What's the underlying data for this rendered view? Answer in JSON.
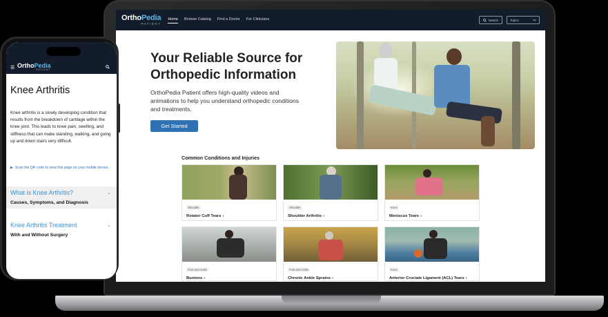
{
  "laptop": {
    "logo": {
      "part1": "Ortho",
      "part2": "Pedia",
      "sub": "PATIENT"
    },
    "nav": [
      "Home",
      "Browse Catalog",
      "Find a Doctor",
      "For Clinicians"
    ],
    "search_label": "Search",
    "topics_label": "Topics",
    "hero": {
      "title": "Your Reliable Source for Orthopedic Information",
      "description": "OrthoPedia Patient offers high-quality videos and animations to help you understand orthopedic conditions and treatments.",
      "cta": "Get Started"
    },
    "section_title": "Common Conditions and Injuries",
    "cards": [
      {
        "tag": "Shoulder",
        "title": "Rotator Cuff Tears"
      },
      {
        "tag": "Shoulder",
        "title": "Shoulder Arthritis"
      },
      {
        "tag": "Knee",
        "title": "Meniscus Tears"
      },
      {
        "tag": "Foot and Ankle",
        "title": "Bunions"
      },
      {
        "tag": "Foot and Ankle",
        "title": "Chronic Ankle Sprains"
      },
      {
        "tag": "Knee",
        "title": "Anterior Cruciate Ligament (ACL) Tears"
      }
    ]
  },
  "phone": {
    "logo": {
      "part1": "Ortho",
      "part2": "Pedia",
      "sub": "PATIENT"
    },
    "title": "Knee Arthritis",
    "body": "Knee arthritis is a slowly developing condition that results from the breakdown of cartilage within the knee joint. This leads to knee pain, swelling, and stiffness that can make standing, walking, and going up and down stairs very difficult.",
    "qr_note": "Scan the QR code to view this page on your mobile device.",
    "accordion": [
      {
        "heading": "What is Knee Arthritis?",
        "sub": "Causes, Symptoms, and Diagnosis"
      },
      {
        "heading": "Knee Arthritis Treatment",
        "sub": "With and Without Surgery"
      }
    ]
  }
}
